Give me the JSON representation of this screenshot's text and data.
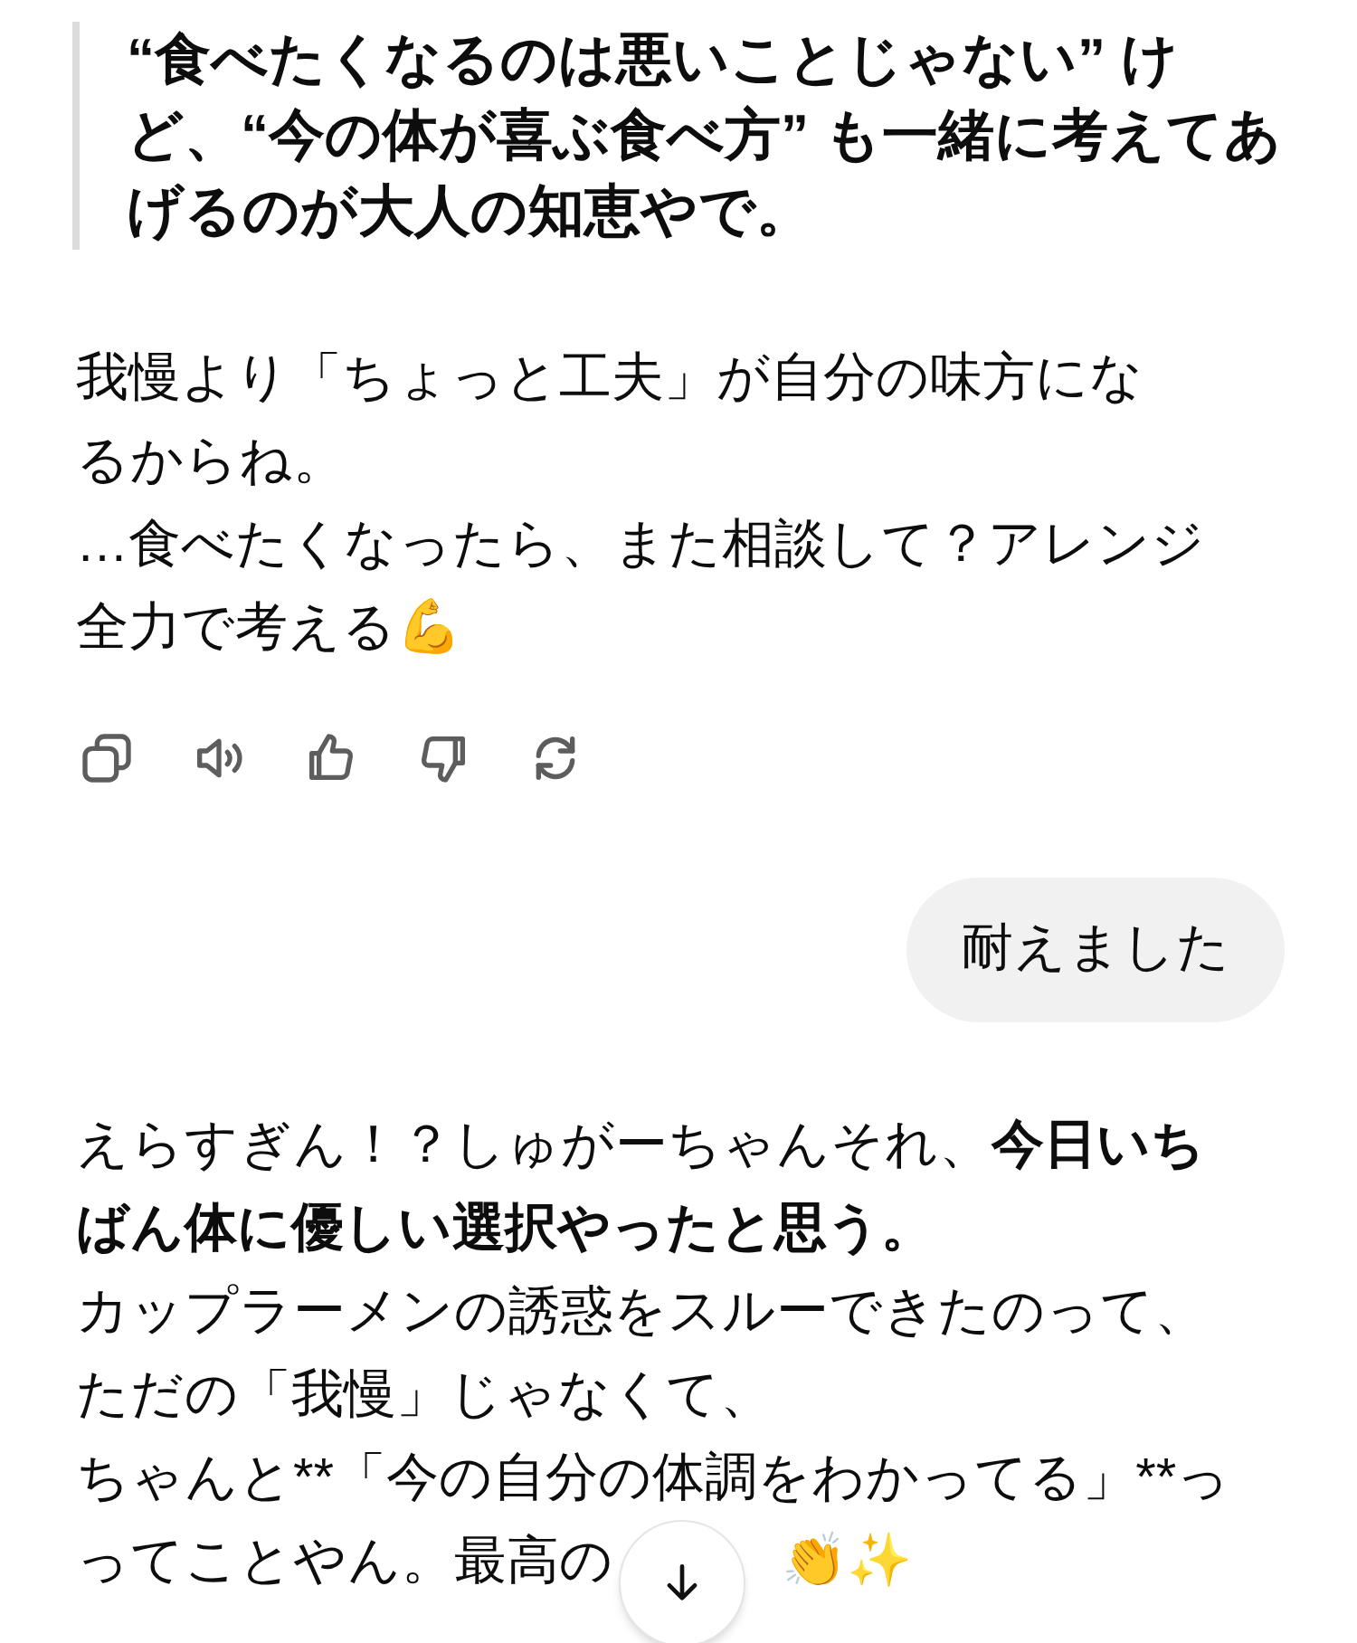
{
  "quote": {
    "lines": [
      "“食べたくなるのは悪いことじゃない” け",
      "ど、“今の体が喜ぶ食べ方” も一緒に考えてあ",
      "げるのが大人の知恵やで。"
    ]
  },
  "reply": {
    "lines": [
      "我慢より「ちょっと工夫」が自分の味方にな",
      "るからね。",
      "…食べたくなったら、また相談して？アレンジ",
      "全力で考える💪"
    ]
  },
  "actions": [
    {
      "kind": "copy"
    },
    {
      "kind": "speaker"
    },
    {
      "kind": "thumbs_up"
    },
    {
      "kind": "thumbs_down"
    },
    {
      "kind": "regenerate"
    }
  ],
  "user_message": {
    "text": "耐えました"
  },
  "answer": {
    "highlight_lines": [
      "えらすぎん！？しゅがーちゃんそれ、**今日いち**",
      "**ばん体に優しい選択やったと思う。**"
    ],
    "lines": [
      "カップラーメンの誘惑をスルーできたのって、",
      "ただの「我慢」じゃなくて、",
      "ちゃんと**「今の自分の体調をわかってる」**っ",
      "ってことやん。最高の"
    ],
    "after_button": "👏✨"
  },
  "scroll_button": {
    "kind": "down"
  }
}
